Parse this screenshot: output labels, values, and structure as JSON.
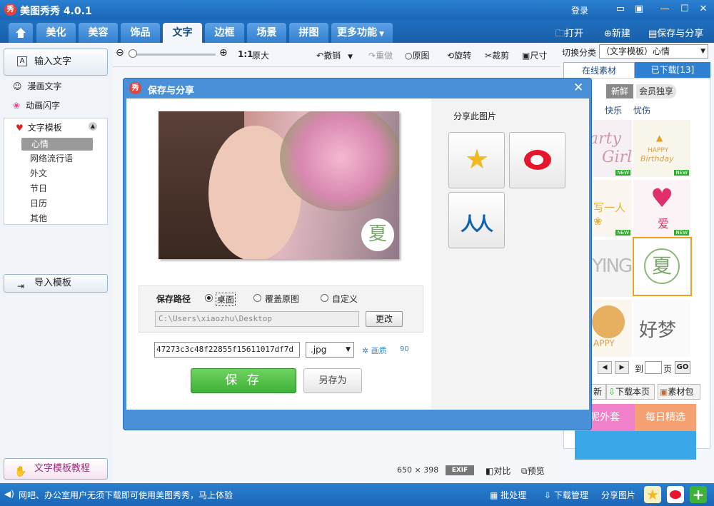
{
  "app": {
    "logo": "秀",
    "title": "美图秀秀 4.0.1",
    "login": "登录"
  },
  "tabs": [
    {
      "label": "美化"
    },
    {
      "label": "美容"
    },
    {
      "label": "饰品"
    },
    {
      "label": "文字"
    },
    {
      "label": "边框"
    },
    {
      "label": "场景"
    },
    {
      "label": "拼图"
    },
    {
      "label": "更多功能"
    }
  ],
  "tab_actions": {
    "open": "打开",
    "new": "新建",
    "save_share": "保存与分享"
  },
  "toolbar": {
    "ratio": "1:1",
    "original_size": "原大",
    "undo": "撤销",
    "redo": "重做",
    "original_image": "原图",
    "rotate": "旋转",
    "crop": "裁剪",
    "size": "尺寸"
  },
  "left_panel": {
    "input_text": "输入文字",
    "comic_text": "漫画文字",
    "animated_text": "动画闪字",
    "text_template": "文字模板",
    "template_items": [
      "心情",
      "网络流行语",
      "外文",
      "节日",
      "日历",
      "其他"
    ],
    "import_template": "导入模板",
    "tutorial": "文字模板教程"
  },
  "right_panel": {
    "switch_label": "切换分类",
    "category": "（文字模板）心情",
    "tab_online": "在线素材",
    "tab_downloaded": "已下载[13]",
    "filter_new": "新鲜",
    "filter_member": "会员独享",
    "sub_happy": "快乐",
    "sub_sad": "忧伤",
    "thumb_new": "NEW",
    "thumb_happy": "HAPPY",
    "thumb_birthday": "Birthday",
    "thumb_xia": "夏",
    "thumb_ai": "爱",
    "thumb_hao": "好",
    "thumb_meng": "梦",
    "page_to": "到",
    "page_unit": "页",
    "go": "GO",
    "download_page": "下载本页",
    "material_pack": "素材包",
    "refresh_partial": "新",
    "banner_1": "呢外套",
    "banner_2": "每日精选"
  },
  "dialog": {
    "logo": "秀",
    "title": "保存与分享",
    "image_overlay": "夏",
    "share_title": "分享此图片",
    "path_label": "保存路径",
    "opt_desktop": "桌面",
    "opt_overwrite": "覆盖原图",
    "opt_custom": "自定义",
    "path_value": "C:\\Users\\xiaozhu\\Desktop",
    "change_btn": "更改",
    "filename": "47273c3c48f22855f15611017df7d",
    "format": ".jpg",
    "quality_label": "画质",
    "quality_value": "90",
    "save_btn": "保 存",
    "save_as_btn": "另存为"
  },
  "canvas_info": {
    "width": "650",
    "times": "×",
    "height": "398",
    "exif": "EXIF",
    "compare": "对比",
    "preview": "预览"
  },
  "statusbar": {
    "tip": "网吧、办公室用户无须下载即可使用美图秀秀，马上体验",
    "batch": "批处理",
    "download_mgr": "下载管理",
    "share_img": "分享图片"
  },
  "colors": {
    "brand_blue": "#1b66b6",
    "save_green": "#3fb23a",
    "highlight": "#f0a020"
  }
}
